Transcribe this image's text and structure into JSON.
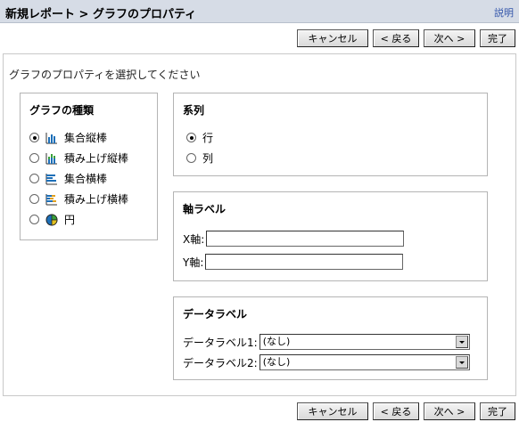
{
  "header": {
    "title": "新規レポート > グラフのプロパティ",
    "help_label": "説明"
  },
  "buttons": {
    "cancel": "キャンセル",
    "back": "< 戻る",
    "next": "次へ >",
    "finish": "完了"
  },
  "instruction": "グラフのプロパティを選択してください",
  "chart_type": {
    "title": "グラフの種類",
    "options": [
      {
        "label": "集合縦棒",
        "icon": "clustered-column-icon",
        "checked": true
      },
      {
        "label": "積み上げ縦棒",
        "icon": "stacked-column-icon",
        "checked": false
      },
      {
        "label": "集合横棒",
        "icon": "clustered-bar-icon",
        "checked": false
      },
      {
        "label": "積み上げ横棒",
        "icon": "stacked-bar-icon",
        "checked": false
      },
      {
        "label": "円",
        "icon": "pie-chart-icon",
        "checked": false
      }
    ]
  },
  "series": {
    "title": "系列",
    "options": [
      {
        "label": "行",
        "checked": true
      },
      {
        "label": "列",
        "checked": false
      }
    ]
  },
  "axis_labels": {
    "title": "軸ラベル",
    "x_label": "X軸:",
    "y_label": "Y軸:",
    "x_value": "",
    "y_value": ""
  },
  "data_labels": {
    "title": "データラベル",
    "label1": "データラベル1:",
    "label2": "データラベル2:",
    "value1": "(なし)",
    "value2": "(なし)"
  },
  "colors": {
    "header_bg": "#d6dce6",
    "link": "#3355aa"
  }
}
